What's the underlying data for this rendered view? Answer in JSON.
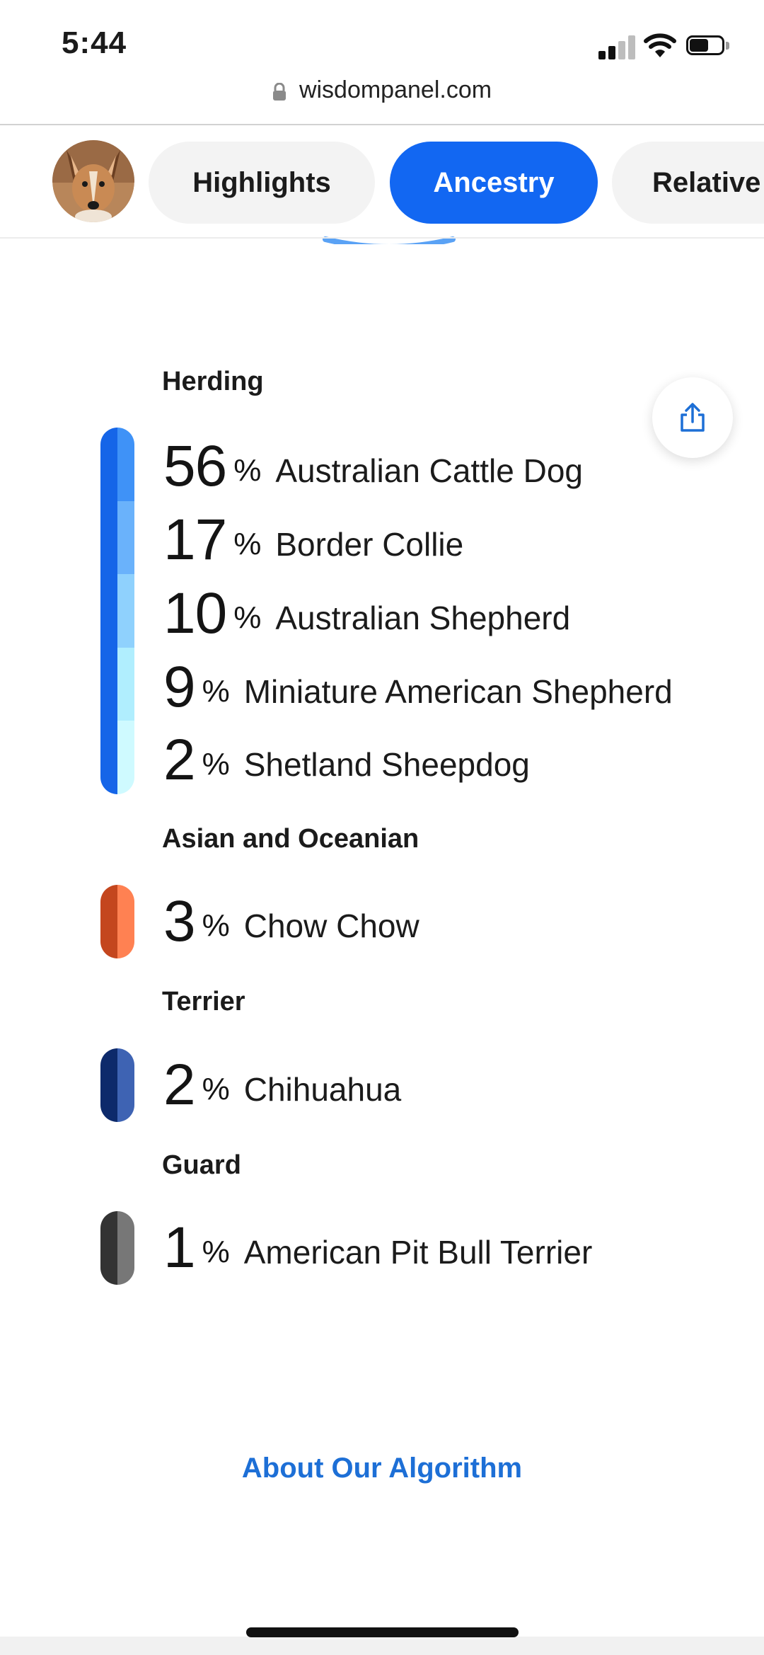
{
  "status_bar": {
    "time": "5:44"
  },
  "url_bar": {
    "domain": "wisdompanel.com"
  },
  "tabs": [
    {
      "label": "Highlights"
    },
    {
      "label": "Ancestry"
    },
    {
      "label": "Relative"
    }
  ],
  "groups": [
    {
      "title": "Herding",
      "breeds": [
        {
          "percent": "56",
          "sign": "%",
          "name": "Australian Cattle Dog"
        },
        {
          "percent": "17",
          "sign": "%",
          "name": "Border Collie"
        },
        {
          "percent": "10",
          "sign": "%",
          "name": "Australian Shepherd"
        },
        {
          "percent": "9",
          "sign": "%",
          "name": "Miniature American Shepherd"
        },
        {
          "percent": "2",
          "sign": "%",
          "name": "Shetland Sheepdog"
        }
      ]
    },
    {
      "title": "Asian and Oceanian",
      "breeds": [
        {
          "percent": "3",
          "sign": "%",
          "name": "Chow Chow"
        }
      ]
    },
    {
      "title": "Terrier",
      "breeds": [
        {
          "percent": "2",
          "sign": "%",
          "name": "Chihuahua"
        }
      ]
    },
    {
      "title": "Guard",
      "breeds": [
        {
          "percent": "1",
          "sign": "%",
          "name": "American Pit Bull Terrier"
        }
      ]
    }
  ],
  "footer": {
    "about_link": "About Our Algorithm"
  },
  "colors": {
    "accent": "#1267f2",
    "link": "#1d6fd6",
    "herding_dark": "#1565e8",
    "herding_shades": [
      "#3f92f7",
      "#6ab2fb",
      "#8fd1fd",
      "#b0eefe",
      "#cffaff"
    ],
    "asian_dark": "#c4461e",
    "asian_light": "#ff8152",
    "terrier_dark": "#0d2a6b",
    "terrier_light": "#3e63b3",
    "guard_dark": "#333333",
    "guard_light": "#777777"
  },
  "icons": {
    "lock": "lock-icon",
    "share": "share-icon",
    "signal": "cellular-signal-icon",
    "wifi": "wifi-icon",
    "battery": "battery-icon"
  }
}
